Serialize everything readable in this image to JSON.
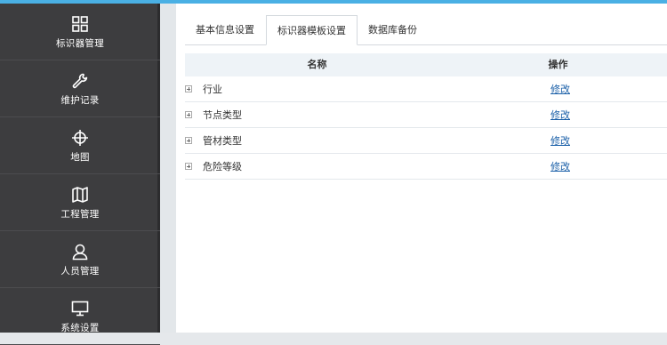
{
  "sidebar": {
    "items": [
      {
        "label": "标识器管理",
        "icon": "grid-icon"
      },
      {
        "label": "维护记录",
        "icon": "wrench-icon"
      },
      {
        "label": "地图",
        "icon": "crosshair-icon"
      },
      {
        "label": "工程管理",
        "icon": "map-icon"
      },
      {
        "label": "人员管理",
        "icon": "user-icon"
      },
      {
        "label": "系统设置",
        "icon": "monitor-icon"
      }
    ]
  },
  "tabs": [
    {
      "label": "基本信息设置"
    },
    {
      "label": "标识器模板设置"
    },
    {
      "label": "数据库备份"
    }
  ],
  "table": {
    "headers": {
      "name": "名称",
      "op": "操作"
    },
    "rows": [
      {
        "name": "行业",
        "op": "修改"
      },
      {
        "name": "节点类型",
        "op": "修改"
      },
      {
        "name": "管材类型",
        "op": "修改"
      },
      {
        "name": "危险等级",
        "op": "修改"
      }
    ]
  },
  "colors": {
    "accent": "#4ab0e4",
    "sidebar": "#3d3d3f",
    "link": "#1a5fa8"
  }
}
